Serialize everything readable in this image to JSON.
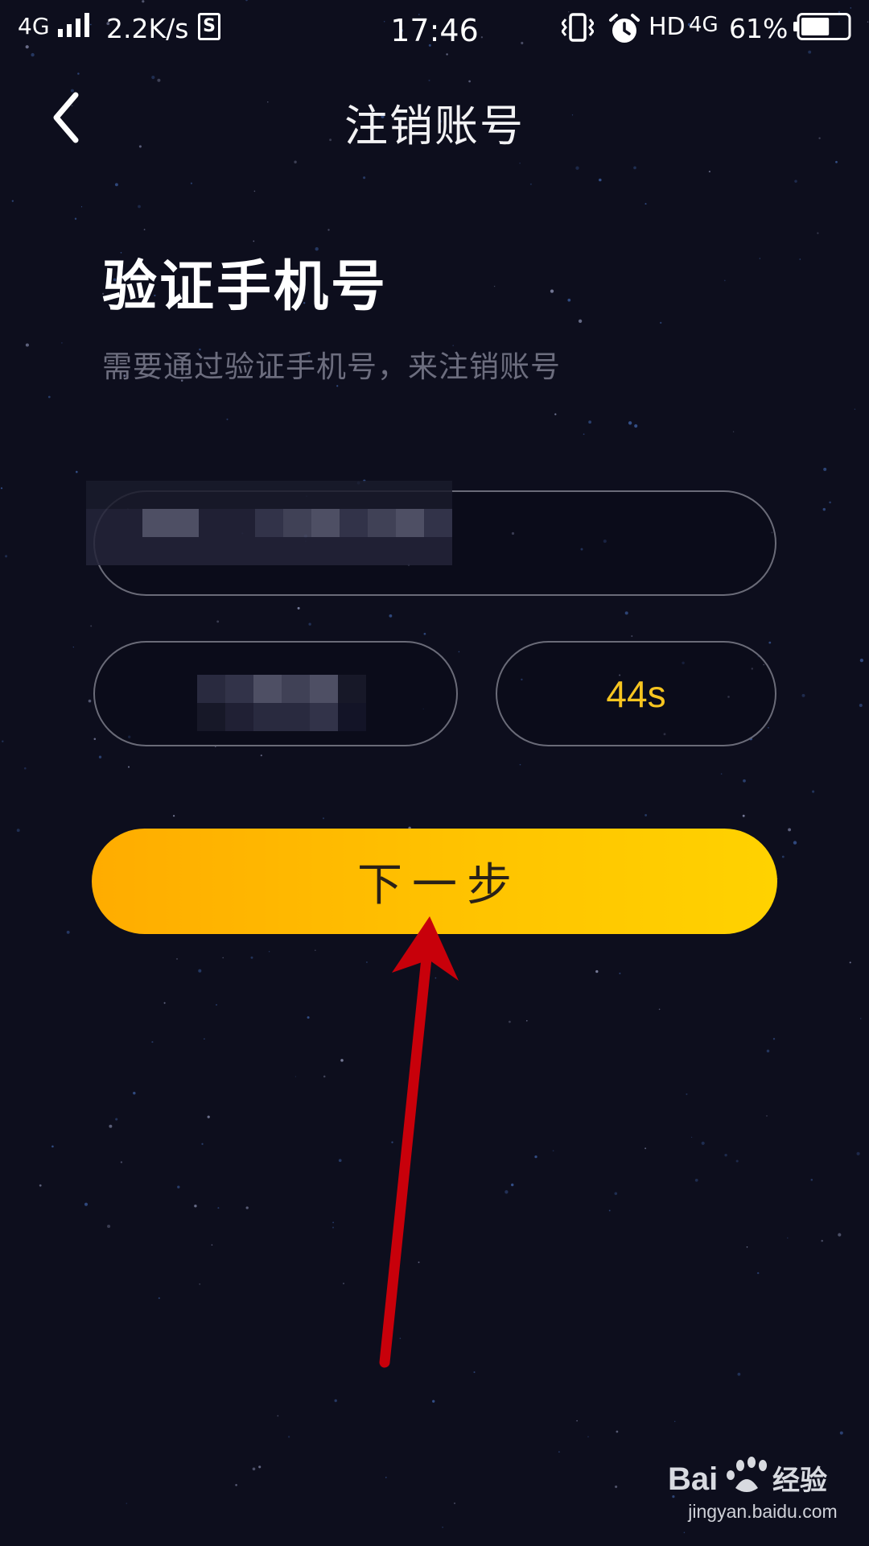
{
  "status_bar": {
    "network_type": "4G",
    "net_speed": "2.2K/s",
    "s_icon_label": "S",
    "time": "17:46",
    "hd": "HD",
    "network_type_2": "4G",
    "battery_percent": "61%",
    "battery_level": 0.61
  },
  "header": {
    "title": "注销账号"
  },
  "section": {
    "title": "验证手机号",
    "subtitle": "需要通过验证手机号，来注销账号"
  },
  "countdown": {
    "label": "44s"
  },
  "next_button": {
    "label": "下一步"
  },
  "watermark": {
    "brand": "Bai 经验",
    "url": "jingyan.baidu.com"
  },
  "colors": {
    "background": "#0d0e1d",
    "accent_yellow": "#ffc300",
    "countdown_text": "#f7c520",
    "arrow_red": "#c8000a"
  }
}
